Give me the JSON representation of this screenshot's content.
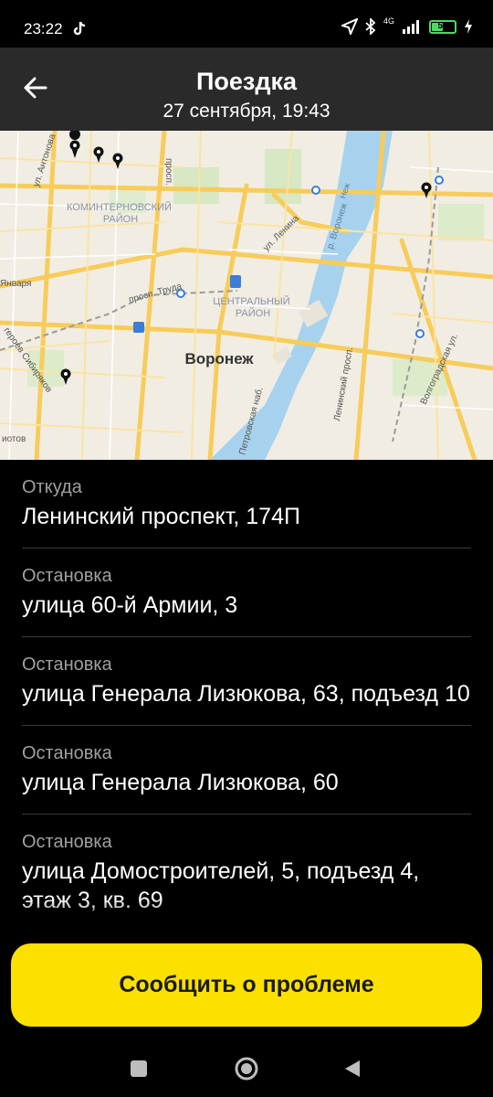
{
  "status_bar": {
    "time": "23:22",
    "network": "4G",
    "battery": "55",
    "battery_level": 0.55
  },
  "header": {
    "title": "Поездка",
    "subtitle": "27 сентября, 19:43"
  },
  "map": {
    "city_label": "Воронеж",
    "district_kominternovsky": [
      "КОМИНТЕРНОВСКИЙ",
      "РАЙОН"
    ],
    "district_central": [
      "ЦЕНТРАЛЬНЫЙ",
      "РАЙОН"
    ],
    "streets": {
      "antonova": "ул. Антонова",
      "prospekt": "просп.",
      "lenina": "ул. Ленина",
      "truda": "просп. Труда",
      "yanvarya": "Января",
      "sibiryakov": "героев Сибиряков",
      "iotov": "иотов",
      "petrovskaya": "Петровская наб.",
      "leninsky": "Ленинский просп.",
      "volgogradskaya": "Волгоградская ул.",
      "voronezh_river": "р. Воронеж",
      "nezh": "Неж"
    }
  },
  "stops": [
    {
      "label": "Откуда",
      "address": "Ленинский проспект, 174П"
    },
    {
      "label": "Остановка",
      "address": "улица 60-й Армии, 3"
    },
    {
      "label": "Остановка",
      "address": "улица Генерала Лизюкова, 63, подъезд 10"
    },
    {
      "label": "Остановка",
      "address": "улица Генерала Лизюкова, 60"
    },
    {
      "label": "Остановка",
      "address": "улица Домостроителей, 5, подъезд 4, этаж 3, кв. 69"
    }
  ],
  "report_button": "Сообщить о проблеме"
}
